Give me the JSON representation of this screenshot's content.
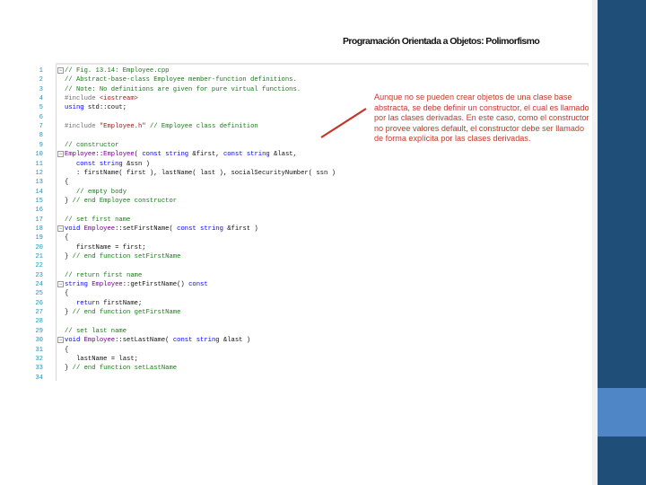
{
  "slide": {
    "title": "Programación Orientada a Objetos: Polimorfismo"
  },
  "code": {
    "lines": [
      {
        "num": "1",
        "fold": "−",
        "html": "<span class='c-comment'>// Fig. 13.14: Employee.cpp</span>"
      },
      {
        "num": "2",
        "fold": "",
        "html": "<span class='c-comment'>// Abstract-base-class Employee member-function definitions.</span>"
      },
      {
        "num": "3",
        "fold": "",
        "html": "<span class='c-comment'>// Note: No definitions are given for pure virtual functions.</span>"
      },
      {
        "num": "4",
        "fold": "",
        "html": "<span class='c-pp'>#include</span> <span class='c-str'>&lt;iostream&gt;</span>"
      },
      {
        "num": "5",
        "fold": "",
        "html": "<span class='c-kw'>using</span> std::cout;"
      },
      {
        "num": "6",
        "fold": "",
        "html": ""
      },
      {
        "num": "7",
        "fold": "",
        "html": "<span class='c-pp'>#include</span> <span class='c-str'>\"Employee.h\"</span> <span class='c-comment'>// Employee class definition</span>"
      },
      {
        "num": "8",
        "fold": "",
        "html": ""
      },
      {
        "num": "9",
        "fold": "",
        "html": "<span class='c-comment'>// constructor</span>"
      },
      {
        "num": "10",
        "fold": "−",
        "html": "<span class='c-id'>Employee</span>::<span class='c-id'>Employee</span>( <span class='c-kw'>const</span> <span class='c-kw'>string</span> &amp;first, <span class='c-kw'>const</span> <span class='c-kw'>string</span> &amp;last,"
      },
      {
        "num": "11",
        "fold": "",
        "html": "   <span class='c-kw'>const</span> <span class='c-kw'>string</span> &amp;ssn )"
      },
      {
        "num": "12",
        "fold": "",
        "html": "   : firstName( first ), lastName( last ), socialSecurityNumber( ssn )"
      },
      {
        "num": "13",
        "fold": "",
        "html": "{"
      },
      {
        "num": "14",
        "fold": "",
        "html": "   <span class='c-comment'>// empty body</span>"
      },
      {
        "num": "15",
        "fold": "",
        "html": "} <span class='c-comment'>// end Employee constructor</span>"
      },
      {
        "num": "16",
        "fold": "",
        "html": ""
      },
      {
        "num": "17",
        "fold": "",
        "html": "<span class='c-comment'>// set first name</span>"
      },
      {
        "num": "18",
        "fold": "−",
        "html": "<span class='c-kw'>void</span> <span class='c-id'>Employee</span>::setFirstName( <span class='c-kw'>const</span> <span class='c-kw'>string</span> &amp;first )"
      },
      {
        "num": "19",
        "fold": "",
        "html": "{"
      },
      {
        "num": "20",
        "fold": "",
        "html": "   firstName = first;"
      },
      {
        "num": "21",
        "fold": "",
        "html": "} <span class='c-comment'>// end function setFirstName</span>"
      },
      {
        "num": "22",
        "fold": "",
        "html": ""
      },
      {
        "num": "23",
        "fold": "",
        "html": "<span class='c-comment'>// return first name</span>"
      },
      {
        "num": "24",
        "fold": "−",
        "html": "<span class='c-kw'>string</span> <span class='c-id'>Employee</span>::getFirstName() <span class='c-kw'>const</span>"
      },
      {
        "num": "25",
        "fold": "",
        "html": "{"
      },
      {
        "num": "26",
        "fold": "",
        "html": "   <span class='c-kw'>return</span> firstName;"
      },
      {
        "num": "27",
        "fold": "",
        "html": "} <span class='c-comment'>// end function getFirstName</span>"
      },
      {
        "num": "28",
        "fold": "",
        "html": ""
      },
      {
        "num": "29",
        "fold": "",
        "html": "<span class='c-comment'>// set last name</span>"
      },
      {
        "num": "30",
        "fold": "−",
        "html": "<span class='c-kw'>void</span> <span class='c-id'>Employee</span>::setLastName( <span class='c-kw'>const</span> <span class='c-kw'>string</span> &amp;last )"
      },
      {
        "num": "31",
        "fold": "",
        "html": "{"
      },
      {
        "num": "32",
        "fold": "",
        "html": "   lastName = last;"
      },
      {
        "num": "33",
        "fold": "",
        "html": "} <span class='c-comment'>// end function setLastName</span>"
      },
      {
        "num": "34",
        "fold": "",
        "html": ""
      }
    ]
  },
  "annotation": {
    "text": "Aunque no se pueden crear objetos de una clase base abstracta, se debe definir un constructor, el cual es llamado por las clases derivadas. En este caso, como el constructor no provee valores default, el constructor debe ser llamado de forma explícita por las clases derivadas.",
    "color": "#c0392b"
  },
  "colors": {
    "sidebar": "#1f4e79",
    "sidebar_accent": "#4f86c6"
  }
}
